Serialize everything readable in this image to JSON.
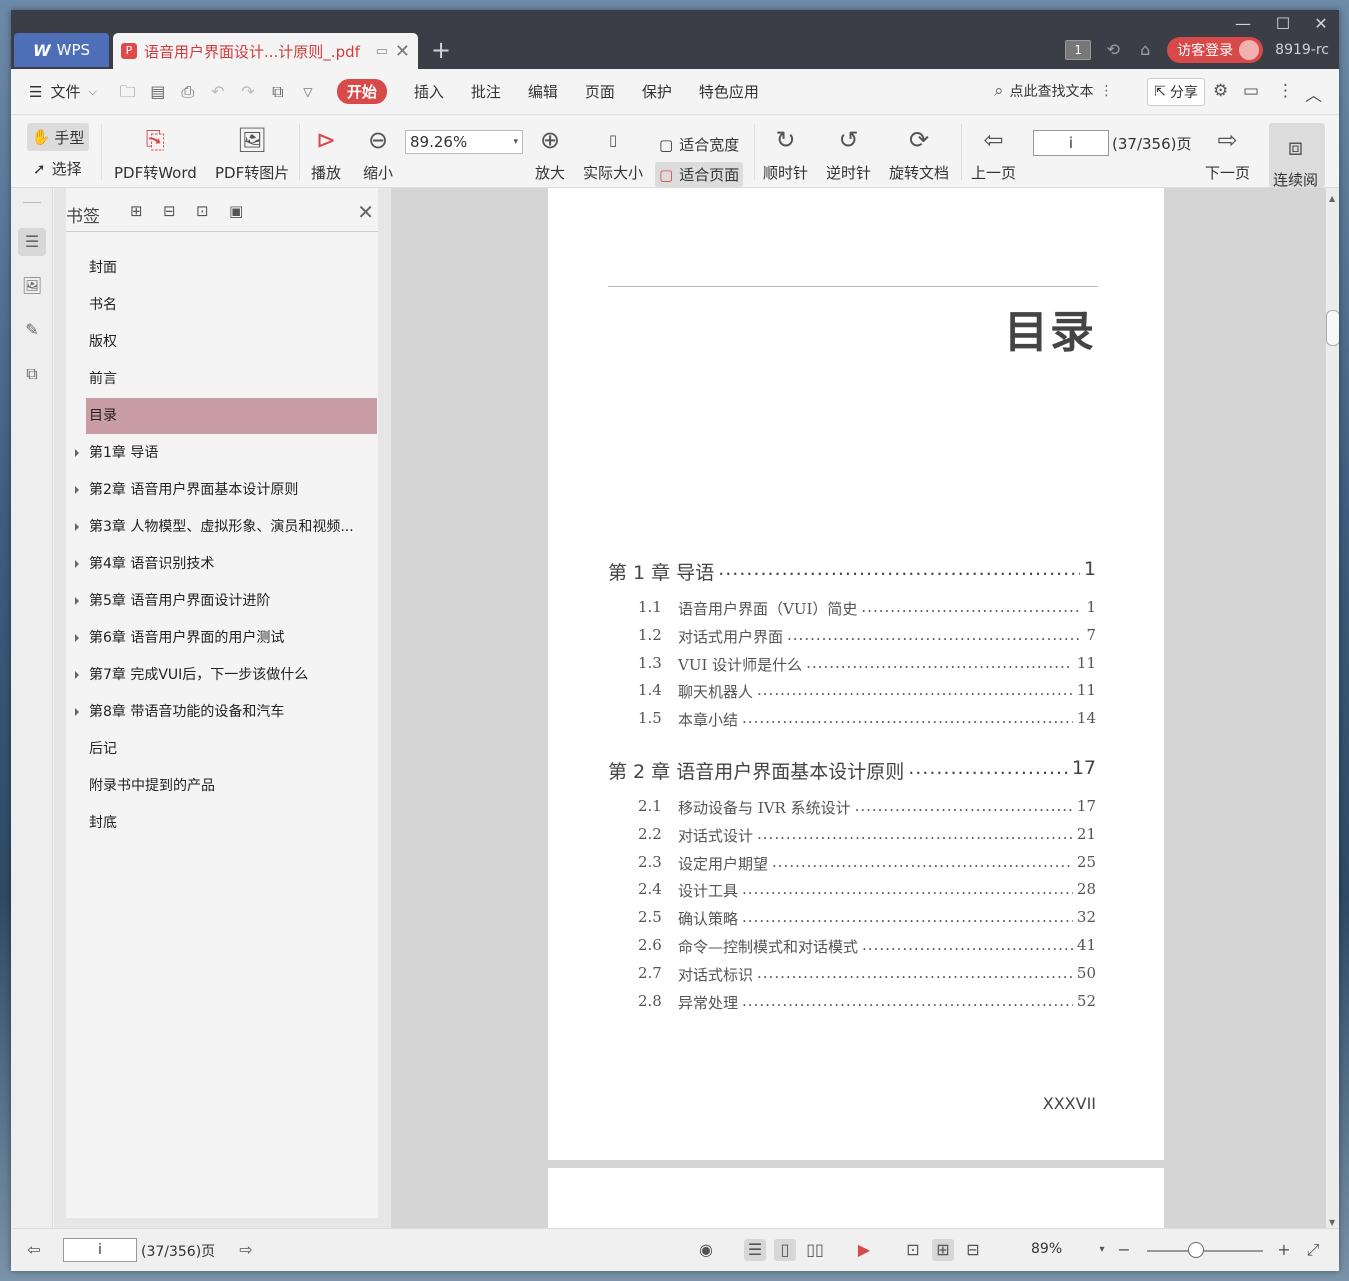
{
  "titlebar": {
    "wps_label": "WPS",
    "doc_tab": "语音用户界面设计...计原则_.pdf",
    "badge": "1",
    "login": "访客登录",
    "user": "8919-rc"
  },
  "menu": {
    "file": "文件",
    "tabs": [
      "开始",
      "插入",
      "批注",
      "编辑",
      "页面",
      "保护",
      "特色应用"
    ],
    "search": "点此查找文本",
    "share": "分享"
  },
  "toolbar": {
    "hand": "手型",
    "select": "选择",
    "pdf_to_word": "PDF转Word",
    "pdf_to_image": "PDF转图片",
    "play": "播放",
    "zoom_out": "缩小",
    "zoom_value": "89.26%",
    "zoom_in": "放大",
    "actual_size": "实际大小",
    "fit_width": "适合宽度",
    "fit_page": "适合页面",
    "clockwise": "顺时针",
    "counter_clockwise": "逆时针",
    "rotate_doc": "旋转文档",
    "prev_page": "上一页",
    "page_value": "i",
    "page_total": "(37/356)页",
    "next_page": "下一页",
    "continuous": "连续阅"
  },
  "bookmarks": {
    "title": "书签",
    "items": [
      {
        "label": "封面",
        "expandable": false
      },
      {
        "label": "书名",
        "expandable": false
      },
      {
        "label": "版权",
        "expandable": false
      },
      {
        "label": "前言",
        "expandable": false
      },
      {
        "label": "目录",
        "expandable": false,
        "selected": true
      },
      {
        "label": "第1章 导语",
        "expandable": true
      },
      {
        "label": "第2章 语音用户界面基本设计原则",
        "expandable": true
      },
      {
        "label": "第3章 人物模型、虚拟形象、演员和视频...",
        "expandable": true
      },
      {
        "label": "第4章 语音识别技术",
        "expandable": true
      },
      {
        "label": "第5章 语音用户界面设计进阶",
        "expandable": true
      },
      {
        "label": "第6章 语音用户界面的用户测试",
        "expandable": true
      },
      {
        "label": "第7章 完成VUI后，下一步该做什么",
        "expandable": true
      },
      {
        "label": "第8章 带语音功能的设备和汽车",
        "expandable": true
      },
      {
        "label": "后记",
        "expandable": false
      },
      {
        "label": "附录书中提到的产品",
        "expandable": false
      },
      {
        "label": "封底",
        "expandable": false
      }
    ]
  },
  "page": {
    "title": "目录",
    "chapters": [
      {
        "label": "第 1 章  导语",
        "page": "1",
        "sections": [
          {
            "num": "1.1",
            "label": "语音用户界面（VUI）简史",
            "page": "1"
          },
          {
            "num": "1.2",
            "label": "对话式用户界面",
            "page": "7"
          },
          {
            "num": "1.3",
            "label": "VUI 设计师是什么",
            "page": "11"
          },
          {
            "num": "1.4",
            "label": "聊天机器人",
            "page": "11"
          },
          {
            "num": "1.5",
            "label": "本章小结",
            "page": "14"
          }
        ]
      },
      {
        "label": "第 2 章  语音用户界面基本设计原则",
        "page": "17",
        "sections": [
          {
            "num": "2.1",
            "label": "移动设备与 IVR 系统设计",
            "page": "17"
          },
          {
            "num": "2.2",
            "label": "对话式设计",
            "page": "21"
          },
          {
            "num": "2.3",
            "label": "设定用户期望",
            "page": "25"
          },
          {
            "num": "2.4",
            "label": "设计工具",
            "page": "28"
          },
          {
            "num": "2.5",
            "label": "确认策略",
            "page": "32"
          },
          {
            "num": "2.6",
            "label": "命令—控制模式和对话模式",
            "page": "41"
          },
          {
            "num": "2.7",
            "label": "对话式标识",
            "page": "50"
          },
          {
            "num": "2.8",
            "label": "异常处理",
            "page": "52"
          }
        ]
      }
    ],
    "page_number": "XXXVII"
  },
  "status": {
    "page_value": "i",
    "page_total": "(37/356)页",
    "zoom": "89%"
  }
}
